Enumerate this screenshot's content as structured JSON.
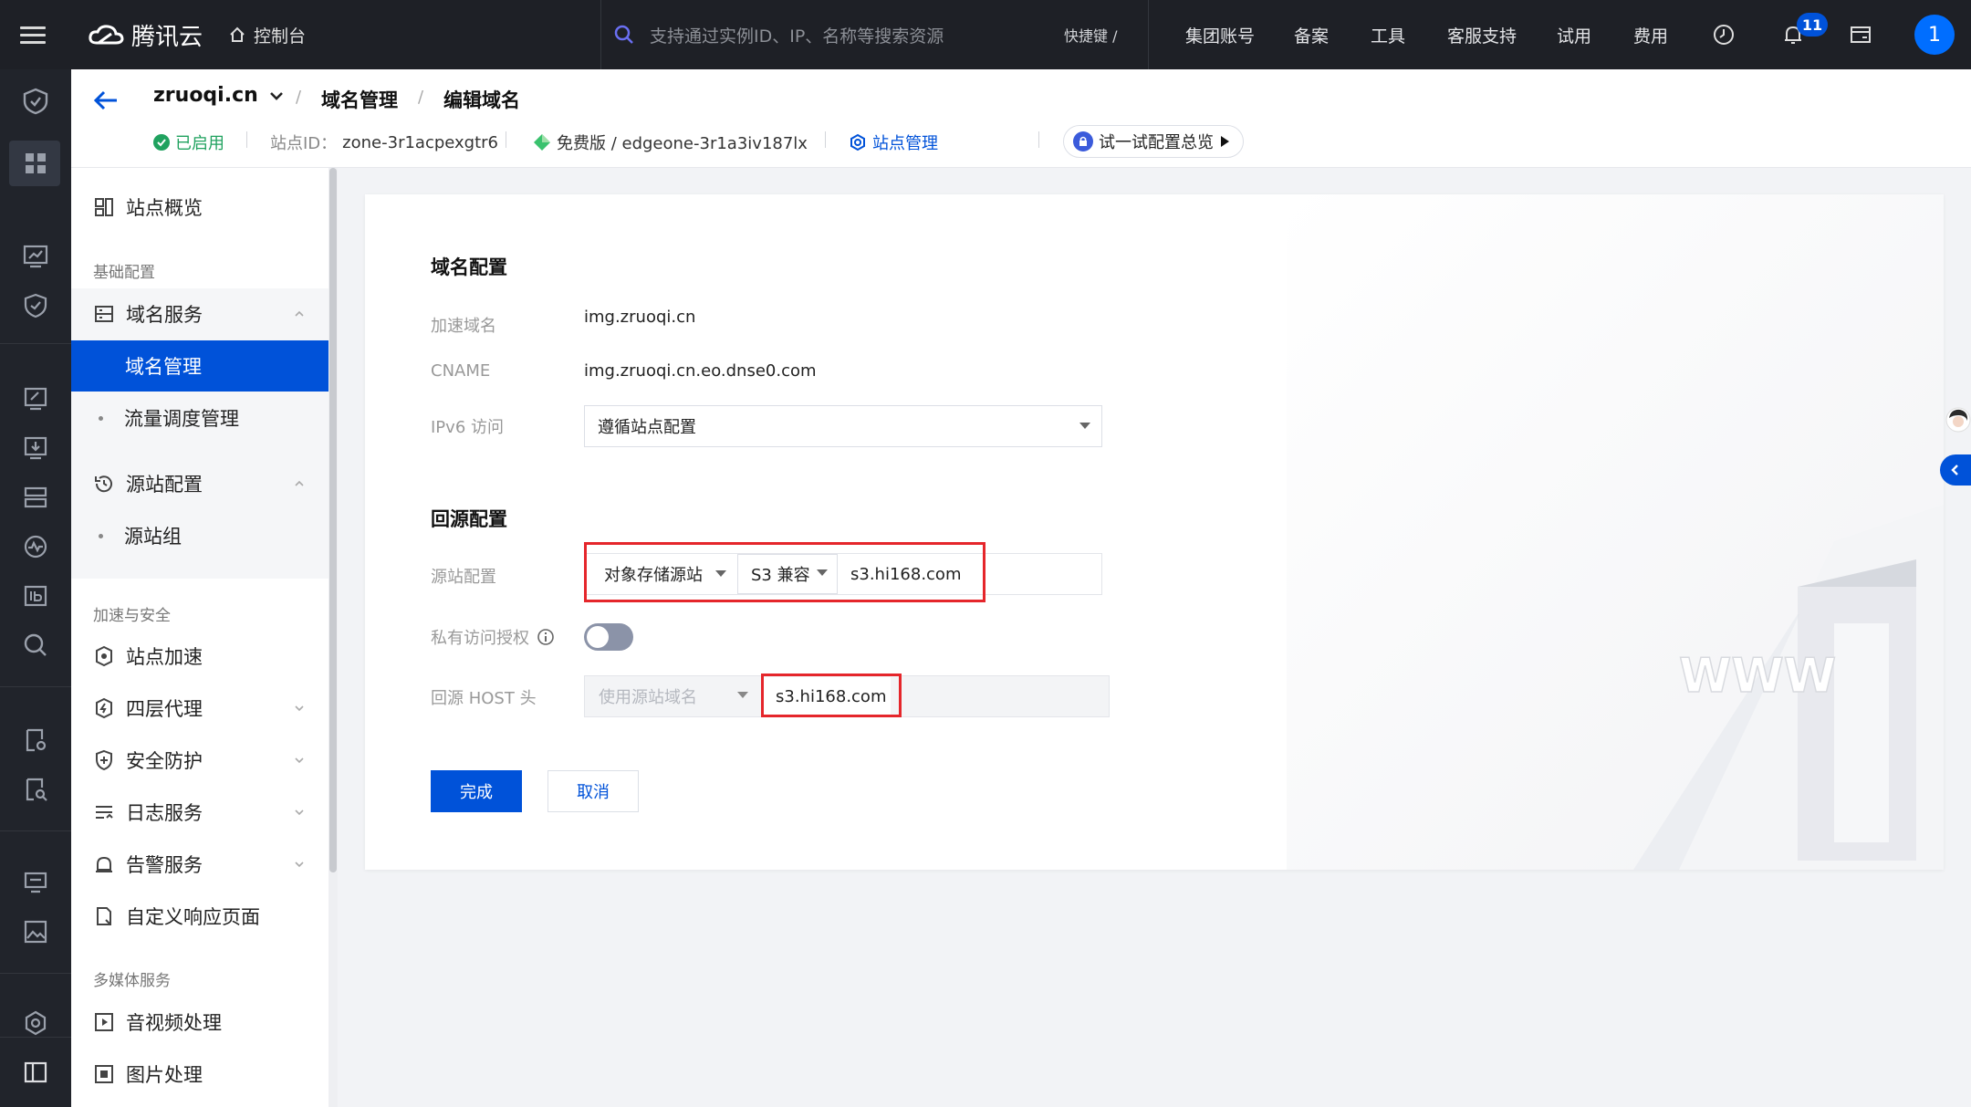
{
  "topbar": {
    "brand": "腾讯云",
    "console": "控制台",
    "search_placeholder": "支持通过实例ID、IP、名称等搜索资源",
    "shortcut": "快捷键 /",
    "nav": [
      "集团账号",
      "备案",
      "工具",
      "客服支持",
      "试用",
      "费用"
    ],
    "notification_count": "11",
    "avatar_initial": "1"
  },
  "header": {
    "zone": "zruoqi.cn",
    "breadcrumbs": [
      "域名管理",
      "编辑域名"
    ],
    "status": "已启用",
    "site_id_label": "站点ID：",
    "site_id": "zone-3r1acpexgtr6",
    "plan": "免费版 / edgeone-3r1a3iv187lx",
    "site_manage": "站点管理",
    "try_config": "试一试配置总览"
  },
  "sidemenu": {
    "overview": "站点概览",
    "basic_title": "基础配置",
    "domain_service": "域名服务",
    "domain_manage": "域名管理",
    "traffic": "流量调度管理",
    "origin_config": "源站配置",
    "origin_group": "源站组",
    "accel_title": "加速与安全",
    "site_accel": "站点加速",
    "l4_proxy": "四层代理",
    "security": "安全防护",
    "log_service": "日志服务",
    "alarm": "告警服务",
    "custom_page": "自定义响应页面",
    "media_title": "多媒体服务",
    "av_process": "音视频处理",
    "image_process": "图片处理"
  },
  "form": {
    "domain_section": "域名配置",
    "accel_domain_label": "加速域名",
    "accel_domain": "img.zruoqi.cn",
    "cname_label": "CNAME",
    "cname": "img.zruoqi.cn.eo.dnse0.com",
    "ipv6_label": "IPv6 访问",
    "ipv6_value": "遵循站点配置",
    "origin_section": "回源配置",
    "origin_label": "源站配置",
    "origin_type": "对象存储源站",
    "origin_compat": "S3 兼容",
    "origin_addr": "s3.hi168.com",
    "private_label": "私有访问授权",
    "private_enabled": false,
    "host_label": "回源 HOST 头",
    "host_mode": "使用源站域名",
    "host_value": "s3.hi168.com",
    "deco_text": "WWW",
    "submit": "完成",
    "cancel": "取消"
  }
}
